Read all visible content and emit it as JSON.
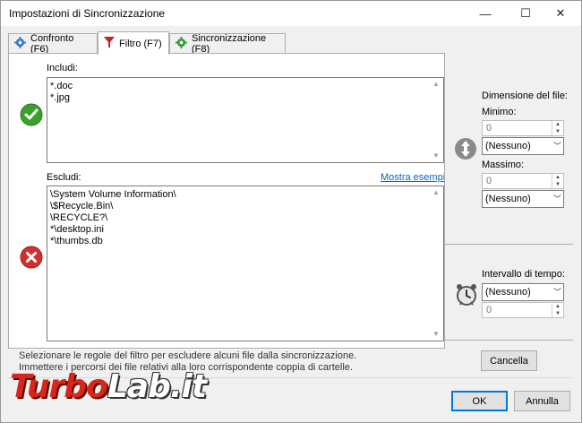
{
  "window": {
    "title": "Impostazioni di Sincronizzazione"
  },
  "titlebar_buttons": {
    "minimize": "—",
    "maximize": "☐",
    "close": "✕"
  },
  "tabs": [
    {
      "label": "Confronto (F6)",
      "icon": "gear-icon-blue"
    },
    {
      "label": "Filtro (F7)",
      "icon": "funnel-icon-red"
    },
    {
      "label": "Sincronizzazione (F8)",
      "icon": "gear-icon-green"
    }
  ],
  "include": {
    "label": "Includi:",
    "lines": [
      "*.doc",
      "*.jpg"
    ]
  },
  "exclude": {
    "label": "Escludi:",
    "link": "Mostra esempi",
    "lines": [
      "\\System Volume Information\\",
      "\\$Recycle.Bin\\",
      "\\RECYCLE?\\",
      "*\\desktop.ini",
      "*\\thumbs.db"
    ]
  },
  "filesize": {
    "title": "Dimensione del file:",
    "min_label": "Minimo:",
    "min_value": "0",
    "min_unit": "(Nessuno)",
    "max_label": "Massimo:",
    "max_value": "0",
    "max_unit": "(Nessuno)"
  },
  "timespan": {
    "title": "Intervallo di tempo:",
    "unit": "(Nessuno)",
    "value": "0"
  },
  "buttons": {
    "cancel": "Cancella",
    "ok": "OK",
    "annulla": "Annulla"
  },
  "footer": {
    "line1": "Selezionare le regole del filtro per escludere alcuni file dalla sincronizzazione.",
    "line2": "Immettere i percorsi dei file relativi alla loro corrispondente coppia di cartelle."
  },
  "watermark": {
    "part1": "Turbo",
    "part2": "Lab.it"
  },
  "colors": {
    "accent": "#0078d7",
    "include_ok": "#3aa12a",
    "exclude_err": "#d32f2f",
    "link": "#0066cc"
  }
}
